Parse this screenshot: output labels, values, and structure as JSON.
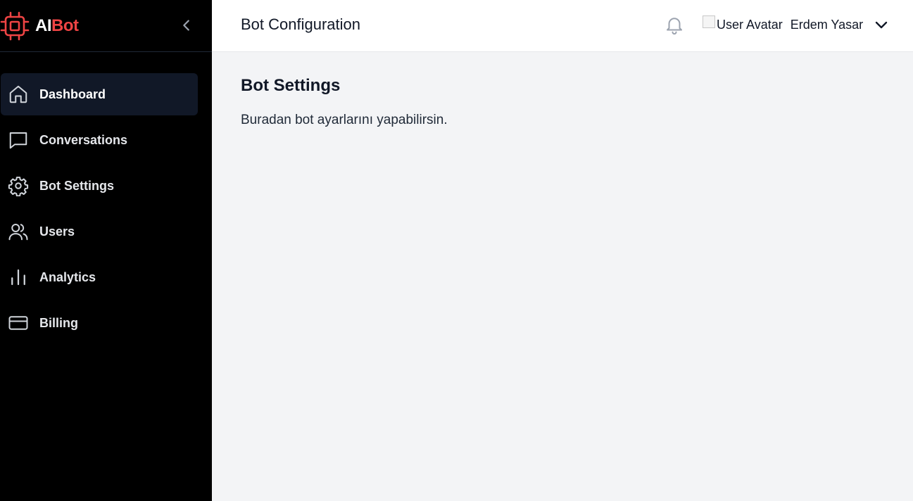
{
  "brand": {
    "prefix": "AI",
    "suffix": "Bot",
    "accent_color": "#ef4444"
  },
  "sidebar": {
    "collapse_icon": "chevron-left-icon",
    "items": [
      {
        "label": "Dashboard",
        "icon": "home-icon",
        "active": true
      },
      {
        "label": "Conversations",
        "icon": "chat-icon",
        "active": false
      },
      {
        "label": "Bot Settings",
        "icon": "gear-icon",
        "active": false
      },
      {
        "label": "Users",
        "icon": "users-icon",
        "active": false
      },
      {
        "label": "Analytics",
        "icon": "bar-chart-icon",
        "active": false
      },
      {
        "label": "Billing",
        "icon": "credit-card-icon",
        "active": false
      }
    ]
  },
  "header": {
    "title": "Bot Configuration",
    "notification_icon": "bell-icon",
    "user": {
      "avatar_alt": "User Avatar",
      "name": "Erdem Yasar",
      "menu_icon": "chevron-down-icon"
    }
  },
  "main": {
    "heading": "Bot Settings",
    "description": "Buradan bot ayarlarını yapabilirsin."
  }
}
